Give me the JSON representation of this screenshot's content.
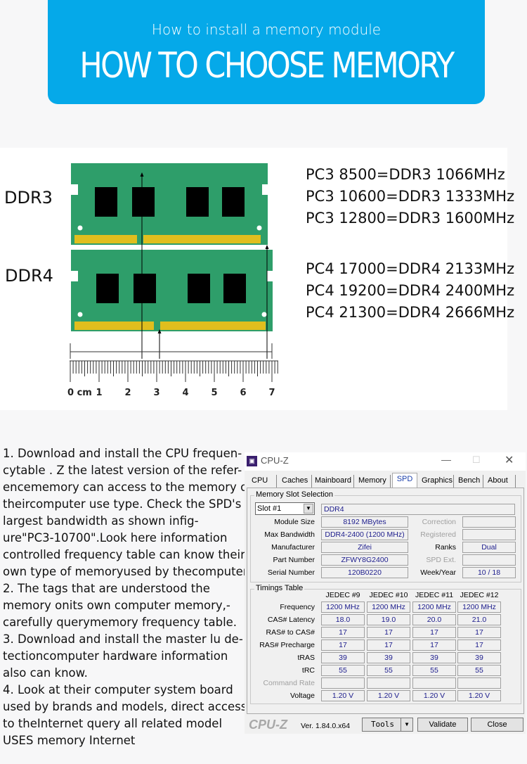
{
  "banner": {
    "subtitle": "How to install a memory module",
    "title": "HOW TO CHOOSE MEMORY",
    "color": "#05a9e9"
  },
  "diagram": {
    "ddr3_label": "DDR3",
    "ddr4_label": "DDR4",
    "ruler_labels": [
      "0 cm",
      "1",
      "2",
      "3",
      "4",
      "5",
      "6",
      "7"
    ],
    "ddr3_specs": [
      "PC3 8500=DDR3 1066MHz",
      "PC3 10600=DDR3 1333MHz",
      "PC3 12800=DDR3 1600MHz"
    ],
    "ddr4_specs": [
      "PC4 17000=DDR4 2133MHz",
      "PC4 19200=DDR4 2400MHz",
      "PC4 21300=DDR4 2666MHz"
    ],
    "pcb_color": "#2e9e6a",
    "contact_color": "#e0be1e"
  },
  "steps": [
    "1. Download and install the CPU frequen-",
    "cytable . Z the latest version of the refer-",
    "encememory can access to the memory of",
    "theircomputer use type. Check the SPD's",
    "largest bandwidth as shown infig-",
    "ure\"PC3-10700\".Look here information",
    "controlled frequency table can know their",
    "own type of memoryused by thecomputer.",
    "2. The tags that are understood the",
    "memory onits own computer memory,-",
    "carefully querymemory frequency table.",
    "3. Download and install the master lu de-",
    "tectioncomputer hardware information",
    "also can know.",
    "4. Look at their computer system board",
    "used by brands and models, direct access",
    "to theInternet query all related model",
    "USES memory Internet"
  ],
  "cpuz": {
    "window_title": "CPU-Z",
    "tabs": [
      "CPU",
      "Caches",
      "Mainboard",
      "Memory",
      "SPD",
      "Graphics",
      "Bench",
      "About"
    ],
    "active_tab": "SPD",
    "slot_group": "Memory Slot Selection",
    "slot": "Slot #1",
    "type": "DDR4",
    "left_fields": [
      [
        "Module Size",
        "8192 MBytes"
      ],
      [
        "Max Bandwidth",
        "DDR4-2400 (1200 MHz)"
      ],
      [
        "Manufacturer",
        "Zifei"
      ],
      [
        "Part Number",
        "ZFWY8G2400"
      ],
      [
        "Serial Number",
        "120B0220"
      ]
    ],
    "right_fields": [
      [
        "Correction",
        ""
      ],
      [
        "Registered",
        ""
      ],
      [
        "Ranks",
        "Dual"
      ],
      [
        "SPD Ext.",
        ""
      ],
      [
        "Week/Year",
        "10 / 18"
      ]
    ],
    "timings_group": "Timings Table",
    "timing_cols": [
      "JEDEC #9",
      "JEDEC #10",
      "JEDEC #11",
      "JEDEC #12"
    ],
    "timing_rows": [
      [
        "Frequency",
        "1200 MHz",
        "1200 MHz",
        "1200 MHz",
        "1200 MHz"
      ],
      [
        "CAS# Latency",
        "18.0",
        "19.0",
        "20.0",
        "21.0"
      ],
      [
        "RAS# to CAS#",
        "17",
        "17",
        "17",
        "17"
      ],
      [
        "RAS# Precharge",
        "17",
        "17",
        "17",
        "17"
      ],
      [
        "tRAS",
        "39",
        "39",
        "39",
        "39"
      ],
      [
        "tRC",
        "55",
        "55",
        "55",
        "55"
      ],
      [
        "Command Rate",
        "",
        "",
        "",
        ""
      ],
      [
        "Voltage",
        "1.20 V",
        "1.20 V",
        "1.20 V",
        "1.20 V"
      ]
    ],
    "brand": "CPU-Z",
    "version": "Ver. 1.84.0.x64",
    "tools": "Tools",
    "validate": "Validate",
    "close": "Close"
  }
}
